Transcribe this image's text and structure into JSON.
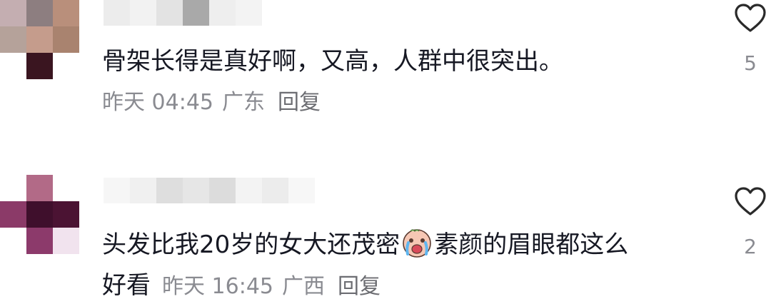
{
  "comments": [
    {
      "text": "骨架长得是真好啊，又高，人群中很突出。",
      "time": "昨天 04:45",
      "location": "广东",
      "reply_label": "回复",
      "like_count": "5",
      "avatar_colors": [
        "#c4aeb1",
        "#8d7e80",
        "#b98f7b",
        "#b5a29a",
        "#c59c8c",
        "#a9836f",
        "#ffffff",
        "#3a1520",
        "#ffffff"
      ],
      "name_colors": [
        "#ececec",
        "#f2f2f2",
        "#e3e3e3",
        "#a9a9a9",
        "#eeeeee",
        "#f3f3f3"
      ]
    },
    {
      "text_before_emoji": "头发比我20岁的女大还茂密",
      "emoji": "crying-face-emoji",
      "text_after_emoji": "素颜的眉眼都这么",
      "text_line2": "好看",
      "time": "昨天 16:45",
      "location": "广西",
      "reply_label": "回复",
      "like_count": "2",
      "avatar_colors": [
        "#ffffff",
        "#b26a87",
        "#ffffff",
        "#8b3a68",
        "#3f0f2c",
        "#4b1333",
        "#ffffff",
        "#8c3a6b",
        "#f1e3ee"
      ],
      "name_colors": [
        "#f6f6f6",
        "#f0f0f0",
        "#dedede",
        "#e6e6e6",
        "#dcdcdc",
        "#f3f3f3",
        "#ececec",
        "#f7f7f7"
      ]
    }
  ]
}
